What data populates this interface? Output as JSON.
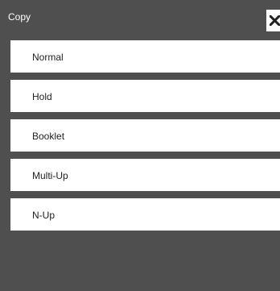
{
  "dialog": {
    "title": "Copy",
    "close_icon": "close-icon"
  },
  "menu": {
    "items": [
      {
        "label": "Normal"
      },
      {
        "label": "Hold"
      },
      {
        "label": "Booklet"
      },
      {
        "label": "Multi-Up"
      },
      {
        "label": "N-Up"
      }
    ]
  },
  "colors": {
    "background": "#505050",
    "header_text": "#ffffff",
    "item_background": "#ffffff",
    "item_text": "#222222"
  }
}
